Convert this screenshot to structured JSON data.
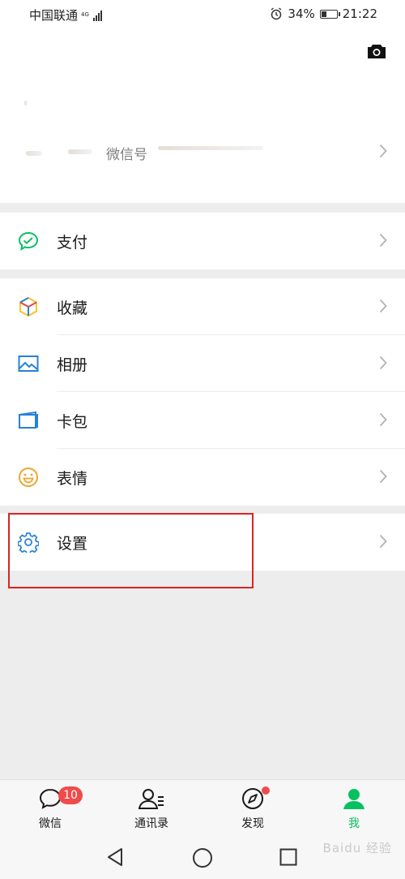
{
  "status_bar": {
    "carrier": "中国联通",
    "network": "4G",
    "battery_percent": "34%",
    "battery_level": 0.34,
    "time": "21:22",
    "icons": [
      "signal-icon",
      "alarm-icon",
      "battery-icon"
    ]
  },
  "profile": {
    "wechat_id_label": "微信号",
    "icons": [
      "camera-icon",
      "chevron-right-icon"
    ]
  },
  "menu": {
    "pay": {
      "label": "支付",
      "icon": "pay-icon",
      "color": "#07c160"
    },
    "favorites": {
      "label": "收藏",
      "icon": "favorites-icon"
    },
    "album": {
      "label": "相册",
      "icon": "album-icon",
      "color": "#2782d7"
    },
    "card_pack": {
      "label": "卡包",
      "icon": "card-pack-icon",
      "color": "#2782d7"
    },
    "stickers": {
      "label": "表情",
      "icon": "stickers-icon",
      "color": "#f0a52b"
    },
    "settings": {
      "label": "设置",
      "icon": "settings-icon",
      "color": "#2782d7"
    }
  },
  "tabs": [
    {
      "label": "微信",
      "icon": "chats-icon",
      "badge": "10"
    },
    {
      "label": "通讯录",
      "icon": "contacts-icon"
    },
    {
      "label": "发现",
      "icon": "discover-icon",
      "dot": true
    },
    {
      "label": "我",
      "icon": "me-icon",
      "active": true
    }
  ],
  "colors": {
    "accent": "#07c160",
    "badge": "#f04b4b",
    "highlight": "#d92424",
    "background": "#ededed"
  },
  "watermark": "Baidu 经验"
}
